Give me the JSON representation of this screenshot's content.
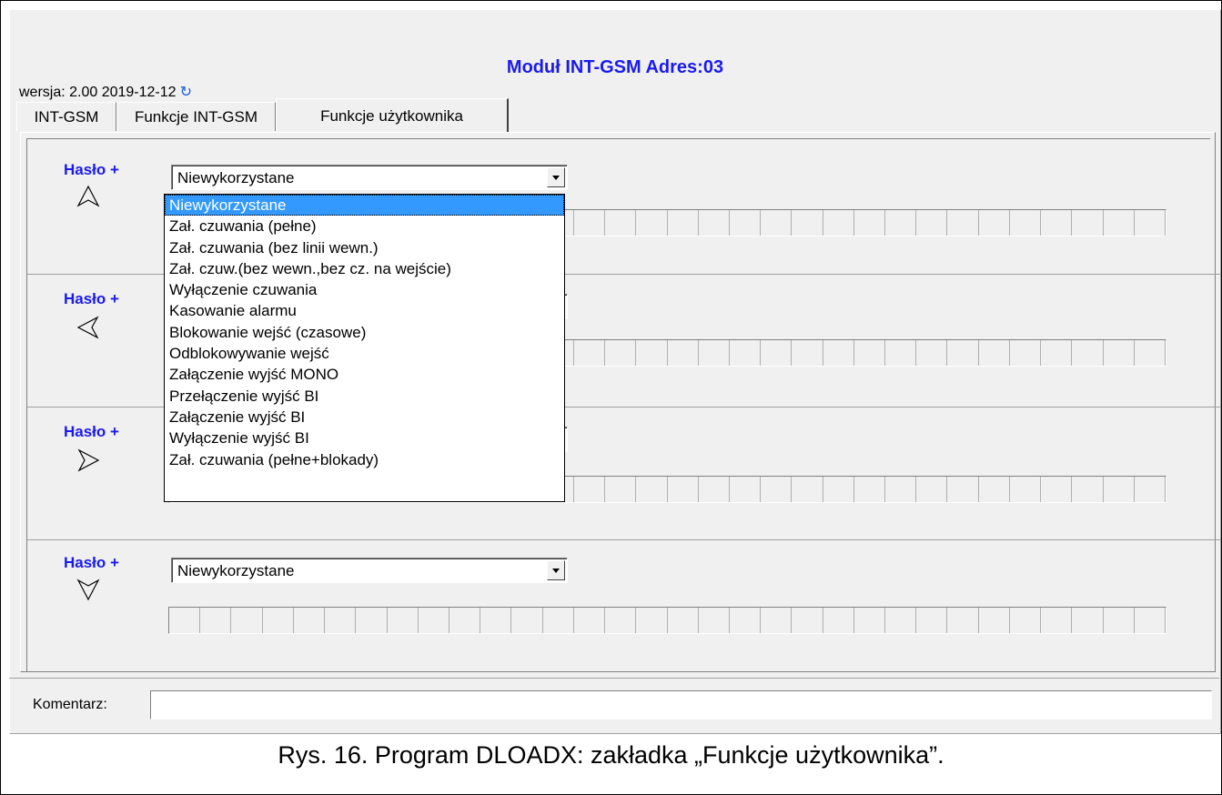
{
  "window": {
    "title": "Moduł INT-GSM Adres:03",
    "version": "wersja: 2.00 2019-12-12"
  },
  "tabs": [
    {
      "label": "INT-GSM"
    },
    {
      "label": "Funkcje INT-GSM"
    },
    {
      "label": "Funkcje użytkownika",
      "active": true
    }
  ],
  "sections": [
    {
      "label": "Hasło +",
      "arrow": "arrow-up-icon",
      "value": "Niewykorzystane"
    },
    {
      "label": "Hasło +",
      "arrow": "arrow-left-icon",
      "value": ""
    },
    {
      "label": "Hasło +",
      "arrow": "arrow-right-icon",
      "value": ""
    },
    {
      "label": "Hasło +",
      "arrow": "arrow-down-icon",
      "value": "Niewykorzystane"
    }
  ],
  "dropdown": {
    "options": [
      "Niewykorzystane",
      "Zał. czuwania (pełne)",
      "Zał. czuwania (bez linii wewn.)",
      "Zał. czuw.(bez wewn.,bez cz. na wejście)",
      "Wyłączenie czuwania",
      "Kasowanie alarmu",
      "Blokowanie wejść (czasowe)",
      "Odblokowywanie wejść",
      "Załączenie wyjść MONO",
      "Przełączenie wyjść BI",
      "Załączenie wyjść BI",
      "Wyłączenie wyjść BI",
      "Zał. czuwania (pełne+blokady)"
    ],
    "selected": "Niewykorzystane"
  },
  "comment": {
    "label": "Komentarz:",
    "value": ""
  },
  "caption": "Rys. 16. Program DLOADX: zakładka „Funkcje użytkownika”.",
  "colors": {
    "title": "#1a1aee",
    "selection": "#3399ff",
    "background": "#f0f0f0"
  }
}
